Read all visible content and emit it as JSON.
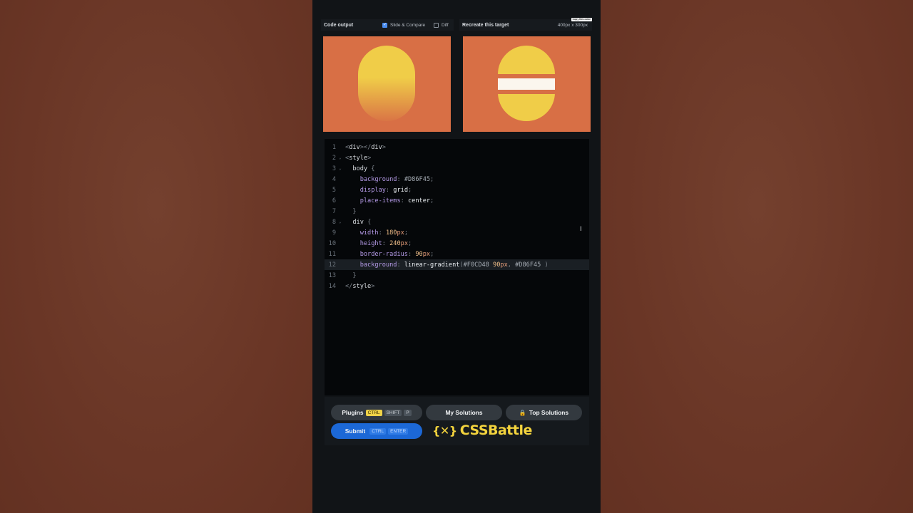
{
  "colors": {
    "background": "#6b3727",
    "panel": "#111417",
    "preview_bg": "#D86F45",
    "preview_yellow": "#F0CD48",
    "accent_blue": "#1c68d6",
    "brand_yellow": "#f3d33d"
  },
  "header": {
    "code_output": "Code output",
    "slide_compare": "Slide & Compare",
    "slide_compare_checked": true,
    "diff": "Diff",
    "diff_checked": false,
    "recreate_target": "Recreate this target",
    "size": "400px x 300px",
    "tooltip": "Copy this color"
  },
  "editor": {
    "lines": [
      {
        "n": "1",
        "fold": ""
      },
      {
        "n": "2",
        "fold": "⌄"
      },
      {
        "n": "3",
        "fold": "⌄"
      },
      {
        "n": "4",
        "fold": ""
      },
      {
        "n": "5",
        "fold": ""
      },
      {
        "n": "6",
        "fold": ""
      },
      {
        "n": "7",
        "fold": ""
      },
      {
        "n": "8",
        "fold": "⌄"
      },
      {
        "n": "9",
        "fold": ""
      },
      {
        "n": "10",
        "fold": ""
      },
      {
        "n": "11",
        "fold": ""
      },
      {
        "n": "12",
        "fold": ""
      },
      {
        "n": "13",
        "fold": ""
      },
      {
        "n": "14",
        "fold": ""
      }
    ],
    "tokens": {
      "div": "div",
      "style": "style",
      "body": "body",
      "background": "background",
      "display": "display",
      "place_items": "place-items",
      "width": "width",
      "height": "height",
      "border_radius": "border-radius",
      "hex_bg": "#D86F45",
      "grid": "grid",
      "center": "center",
      "width_val": "180",
      "height_val": "240",
      "radius_val": "90",
      "px": "px",
      "linear_gradient": "linear-gradient",
      "hex_yellow": "#F0CD48",
      "stop_val": "90",
      "hex_end": "#D86F45"
    }
  },
  "buttons": {
    "plugins": "Plugins",
    "plugins_keys": [
      "CTRL",
      "SHIFT",
      "P"
    ],
    "my_solutions": "My Solutions",
    "top_solutions": "Top Solutions",
    "submit": "Submit",
    "submit_keys": [
      "CTRL",
      "ENTER"
    ]
  },
  "brand": {
    "logo_mark": "{✕}",
    "name": "CSSBattle"
  }
}
